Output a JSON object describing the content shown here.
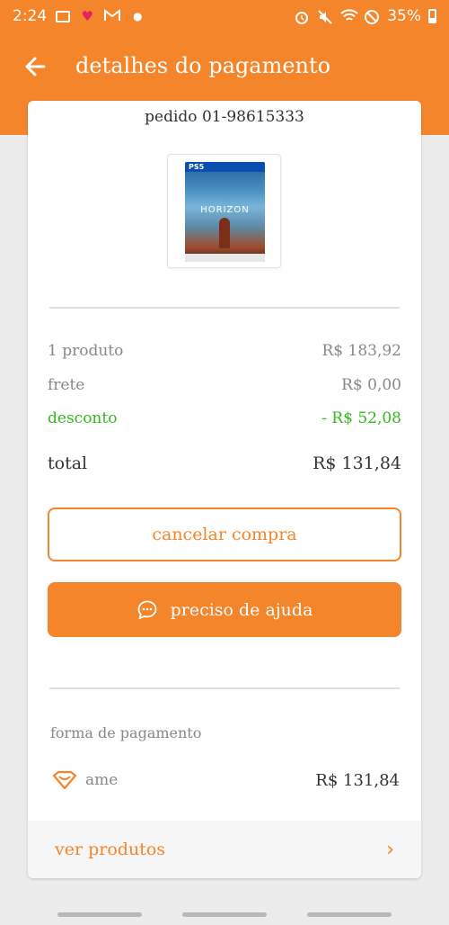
{
  "status_bar": {
    "time": "2:24",
    "battery_pct": "35%",
    "icons_left": [
      "gallery-icon",
      "heart-icon",
      "gmail-icon",
      "dot-icon"
    ],
    "icons_right": [
      "alarm-icon",
      "mute-icon",
      "wifi-icon",
      "do-not-disturb-icon",
      "battery-icon"
    ]
  },
  "header": {
    "title": "detalhes do pagamento",
    "back_icon": "arrow-left-icon"
  },
  "order": {
    "number_text": "pedido 01-98615333",
    "product_image_title": "HORIZON",
    "product_platform": "PS5"
  },
  "summary": {
    "items_label": "1 produto",
    "items_value": "R$ 183,92",
    "shipping_label": "frete",
    "shipping_value": "R$ 0,00",
    "discount_label": "desconto",
    "discount_value": "- R$ 52,08",
    "total_label": "total",
    "total_value": "R$ 131,84"
  },
  "actions": {
    "cancel_label": "cancelar compra",
    "help_label": "preciso de ajuda",
    "help_icon": "chat-bubble-icon"
  },
  "payment": {
    "heading": "forma de pagamento",
    "method": "ame",
    "method_icon": "ame-heart-icon",
    "amount": "R$ 131,84"
  },
  "footer": {
    "link_label": "ver produtos",
    "chevron_icon": "chevron-right-icon"
  },
  "colors": {
    "brand_orange": "#f5852a",
    "discount_green": "#36b820",
    "text_dark": "#333333",
    "text_muted": "#888888"
  }
}
